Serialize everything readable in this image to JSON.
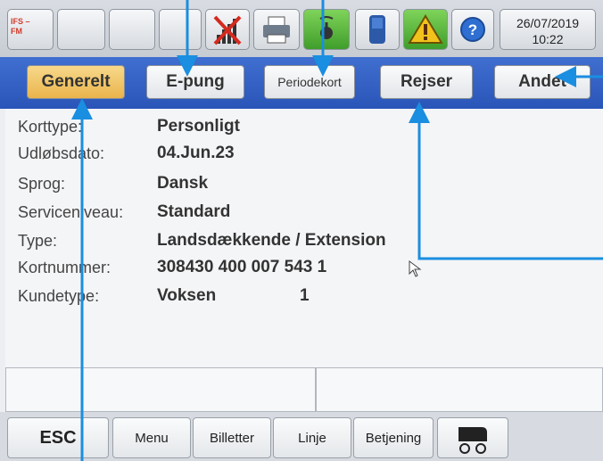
{
  "status_bar": {
    "ifs_label": "IFS –\nFM",
    "icons": [
      "no-signal-icon",
      "printer-icon",
      "gps-icon",
      "card-reader-icon",
      "warning-icon",
      "help-icon"
    ],
    "date": "26/07/2019",
    "time": "10:22"
  },
  "tabs": [
    {
      "label": "Generelt",
      "active": true
    },
    {
      "label": "E-pung",
      "active": false
    },
    {
      "label": "Periodekort",
      "active": false
    },
    {
      "label": "Rejser",
      "active": false
    },
    {
      "label": "Andet",
      "active": false
    }
  ],
  "info": {
    "rows": [
      {
        "label": "Korttype:",
        "value": "Personligt"
      },
      {
        "label": "Udløbsdato:",
        "value": "04.Jun.23"
      },
      {
        "label": "Sprog:",
        "value": "Dansk"
      },
      {
        "label": "Serviceniveau:",
        "value": "Standard"
      },
      {
        "label": "Type:",
        "value": "Landsdækkende / Extension"
      },
      {
        "label": "Kortnummer:",
        "value": "308430 400 007 543 1"
      },
      {
        "label": "Kundetype:",
        "value": "Voksen",
        "extra": "1"
      }
    ]
  },
  "bottom_bar": {
    "esc": "ESC",
    "menu": "Menu",
    "tickets": "Billetter",
    "line": "Linje",
    "service": "Betjening",
    "stroller_icon": "stroller-icon"
  },
  "colors": {
    "tab_bar": "#2f5fc4",
    "active_tab": "#eab44c",
    "annotation": "#1a8ee0"
  }
}
